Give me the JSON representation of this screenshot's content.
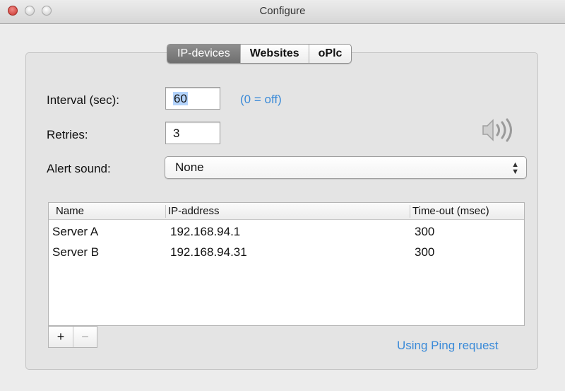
{
  "window": {
    "title": "Configure"
  },
  "tabs": [
    {
      "label": "IP-devices",
      "active": true
    },
    {
      "label": "Websites",
      "active": false
    },
    {
      "label": "oPlc",
      "active": false
    }
  ],
  "form": {
    "interval_label": "Interval (sec):",
    "interval_value": "60",
    "interval_hint": "(0 = off)",
    "retries_label": "Retries:",
    "retries_value": "3",
    "alert_label": "Alert sound:",
    "alert_value": "None"
  },
  "table": {
    "columns": [
      "Name",
      "IP-address",
      "Time-out (msec)"
    ],
    "rows": [
      {
        "name": "Server A",
        "ip": "192.168.94.1",
        "timeout": "300"
      },
      {
        "name": "Server B",
        "ip": "192.168.94.31",
        "timeout": "300"
      }
    ]
  },
  "buttons": {
    "add_label": "+",
    "remove_label": "−"
  },
  "status": {
    "ping_text": "Using Ping request"
  },
  "icons": {
    "sound": "speaker-sound-icon",
    "dropdown": "up-down-chevron-icon"
  },
  "colors": {
    "accent": "#3a8ad8",
    "selection": "#b3d3fb",
    "active_tab": "#7d7d7d"
  }
}
